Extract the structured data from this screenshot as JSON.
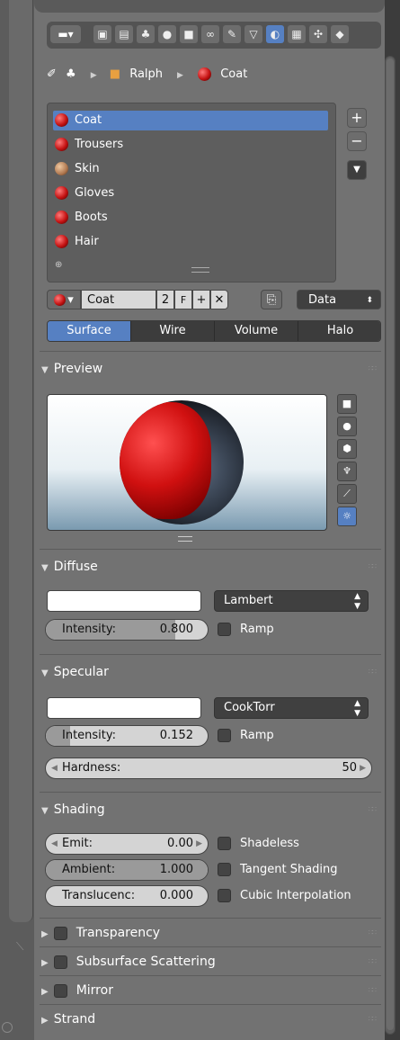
{
  "breadcrumb": {
    "object": "Ralph",
    "material": "Coat"
  },
  "materials": [
    "Coat",
    "Trousers",
    "Skin",
    "Gloves",
    "Boots",
    "Hair"
  ],
  "selected_material": "Coat",
  "datablock": {
    "name": "Coat",
    "users": "2",
    "fake": "F",
    "link": "Data"
  },
  "modes": [
    "Surface",
    "Wire",
    "Volume",
    "Halo"
  ],
  "active_mode": "Surface",
  "sections": {
    "preview": "Preview",
    "diffuse": "Diffuse",
    "specular": "Specular",
    "shading": "Shading",
    "transparency": "Transparency",
    "subsurface": "Subsurface Scattering",
    "mirror": "Mirror",
    "strand": "Strand"
  },
  "diffuse": {
    "shader": "Lambert",
    "intensity_label": "Intensity:",
    "intensity": "0.800",
    "intensity_fraction": 0.8,
    "ramp": "Ramp"
  },
  "specular": {
    "shader": "CookTorr",
    "intensity_label": "Intensity:",
    "intensity": "0.152",
    "intensity_fraction": 0.152,
    "ramp": "Ramp",
    "hardness_label": "Hardness:",
    "hardness": "50"
  },
  "shading": {
    "emit_label": "Emit:",
    "emit": "0.00",
    "ambient_label": "Ambient:",
    "ambient": "1.000",
    "ambient_fraction": 1.0,
    "translucency_label": "Translucenc:",
    "translucency": "0.000",
    "shadeless": "Shadeless",
    "tangent": "Tangent Shading",
    "cubic": "Cubic Interpolation"
  },
  "colors": {
    "accent": "#5680c2",
    "panel": "#727272"
  }
}
